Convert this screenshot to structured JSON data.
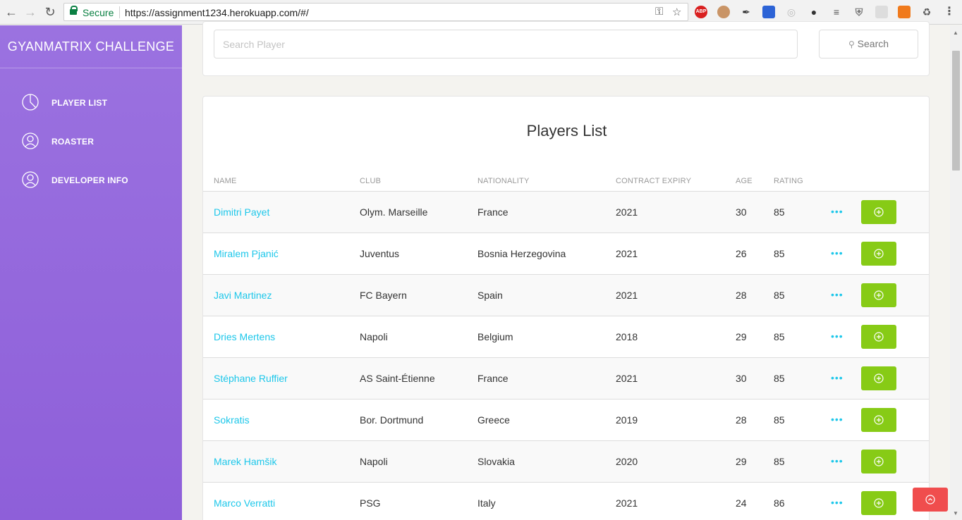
{
  "browser": {
    "secure_label": "Secure",
    "url": "https://assignment1234.herokuapp.com/#/",
    "abp_label": "ABP"
  },
  "sidebar": {
    "brand": "GYANMATRIX CHALLENGE",
    "items": [
      {
        "label": "PLAYER LIST",
        "icon": "pie-chart-icon"
      },
      {
        "label": "ROASTER",
        "icon": "user-icon"
      },
      {
        "label": "DEVELOPER INFO",
        "icon": "user-icon"
      }
    ]
  },
  "search": {
    "placeholder": "Search Player",
    "button_label": "Search",
    "button_icon": "search-icon"
  },
  "players": {
    "title": "Players List",
    "columns": [
      "NAME",
      "CLUB",
      "NATIONALITY",
      "CONTRACT EXPIRY",
      "AGE",
      "RATING"
    ],
    "rows": [
      {
        "name": "Dimitri Payet",
        "club": "Olym. Marseille",
        "nationality": "France",
        "contract": "2021",
        "age": "30",
        "rating": "85"
      },
      {
        "name": "Miralem Pjanić",
        "club": "Juventus",
        "nationality": "Bosnia Herzegovina",
        "contract": "2021",
        "age": "26",
        "rating": "85"
      },
      {
        "name": "Javi Martinez",
        "club": "FC Bayern",
        "nationality": "Spain",
        "contract": "2021",
        "age": "28",
        "rating": "85"
      },
      {
        "name": "Dries Mertens",
        "club": "Napoli",
        "nationality": "Belgium",
        "contract": "2018",
        "age": "29",
        "rating": "85"
      },
      {
        "name": "Stéphane Ruffier",
        "club": "AS Saint-Étienne",
        "nationality": "France",
        "contract": "2021",
        "age": "30",
        "rating": "85"
      },
      {
        "name": "Sokratis",
        "club": "Bor. Dortmund",
        "nationality": "Greece",
        "contract": "2019",
        "age": "28",
        "rating": "85"
      },
      {
        "name": "Marek Hamšik",
        "club": "Napoli",
        "nationality": "Slovakia",
        "contract": "2020",
        "age": "29",
        "rating": "85"
      },
      {
        "name": "Marco Verratti",
        "club": "PSG",
        "nationality": "Italy",
        "contract": "2021",
        "age": "24",
        "rating": "86"
      }
    ],
    "more_label": "•••"
  },
  "colors": {
    "sidebar": "#9b72e0",
    "link": "#1dc7ea",
    "add_button": "#87cb16",
    "scroll_top_button": "#f04d4d"
  }
}
